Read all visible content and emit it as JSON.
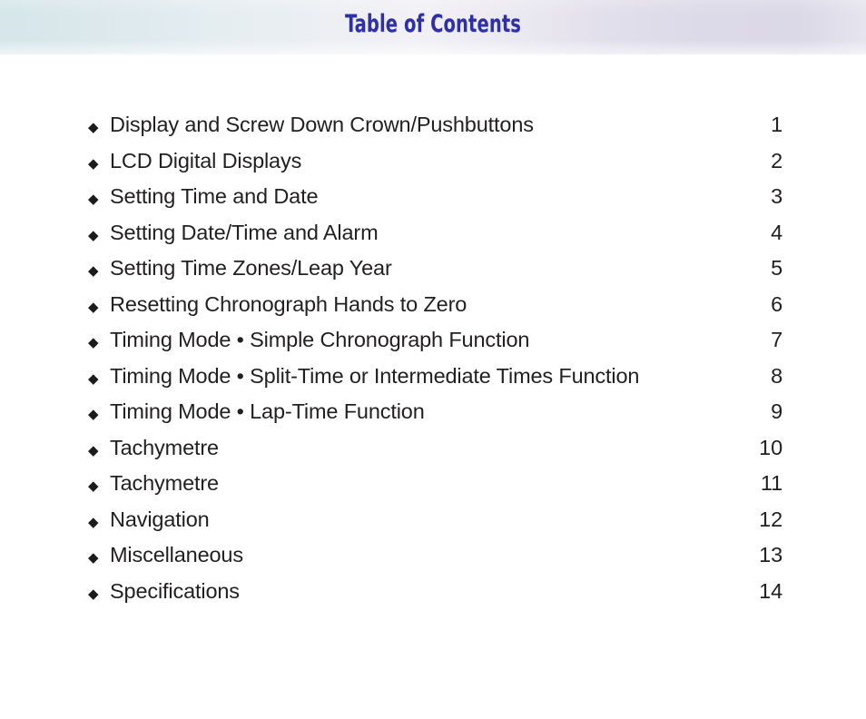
{
  "header": {
    "title": "Table of Contents",
    "title_color": "#2f2fa8",
    "gradient_left_color": "#d6e6ea",
    "gradient_mid_color": "#f2f1f5",
    "gradient_right_color": "#dcd9e8"
  },
  "page": {
    "background_color": "#ffffff",
    "text_color": "#231f20",
    "bullet_glyph": "◆",
    "bullet_icon_name": "diamond-bullet-icon"
  },
  "toc": {
    "entries": [
      {
        "label": "Display and Screw Down Crown/Pushbuttons",
        "page": "1"
      },
      {
        "label": "LCD Digital Displays",
        "page": "2"
      },
      {
        "label": "Setting Time and Date",
        "page": "3"
      },
      {
        "label": "Setting Date/Time and Alarm",
        "page": "4"
      },
      {
        "label": "Setting Time Zones/Leap Year",
        "page": "5"
      },
      {
        "label": "Resetting Chronograph Hands to Zero",
        "page": "6"
      },
      {
        "label": "Timing Mode • Simple Chronograph Function",
        "page": "7"
      },
      {
        "label": "Timing Mode • Split-Time or Intermediate Times Function",
        "page": "8"
      },
      {
        "label": "Timing Mode • Lap-Time Function",
        "page": "9"
      },
      {
        "label": "Tachymetre",
        "page": "10"
      },
      {
        "label": "Tachymetre",
        "page": "11"
      },
      {
        "label": "Navigation",
        "page": "12"
      },
      {
        "label": "Miscellaneous",
        "page": "13"
      },
      {
        "label": "Specifications",
        "page": "14"
      }
    ]
  }
}
